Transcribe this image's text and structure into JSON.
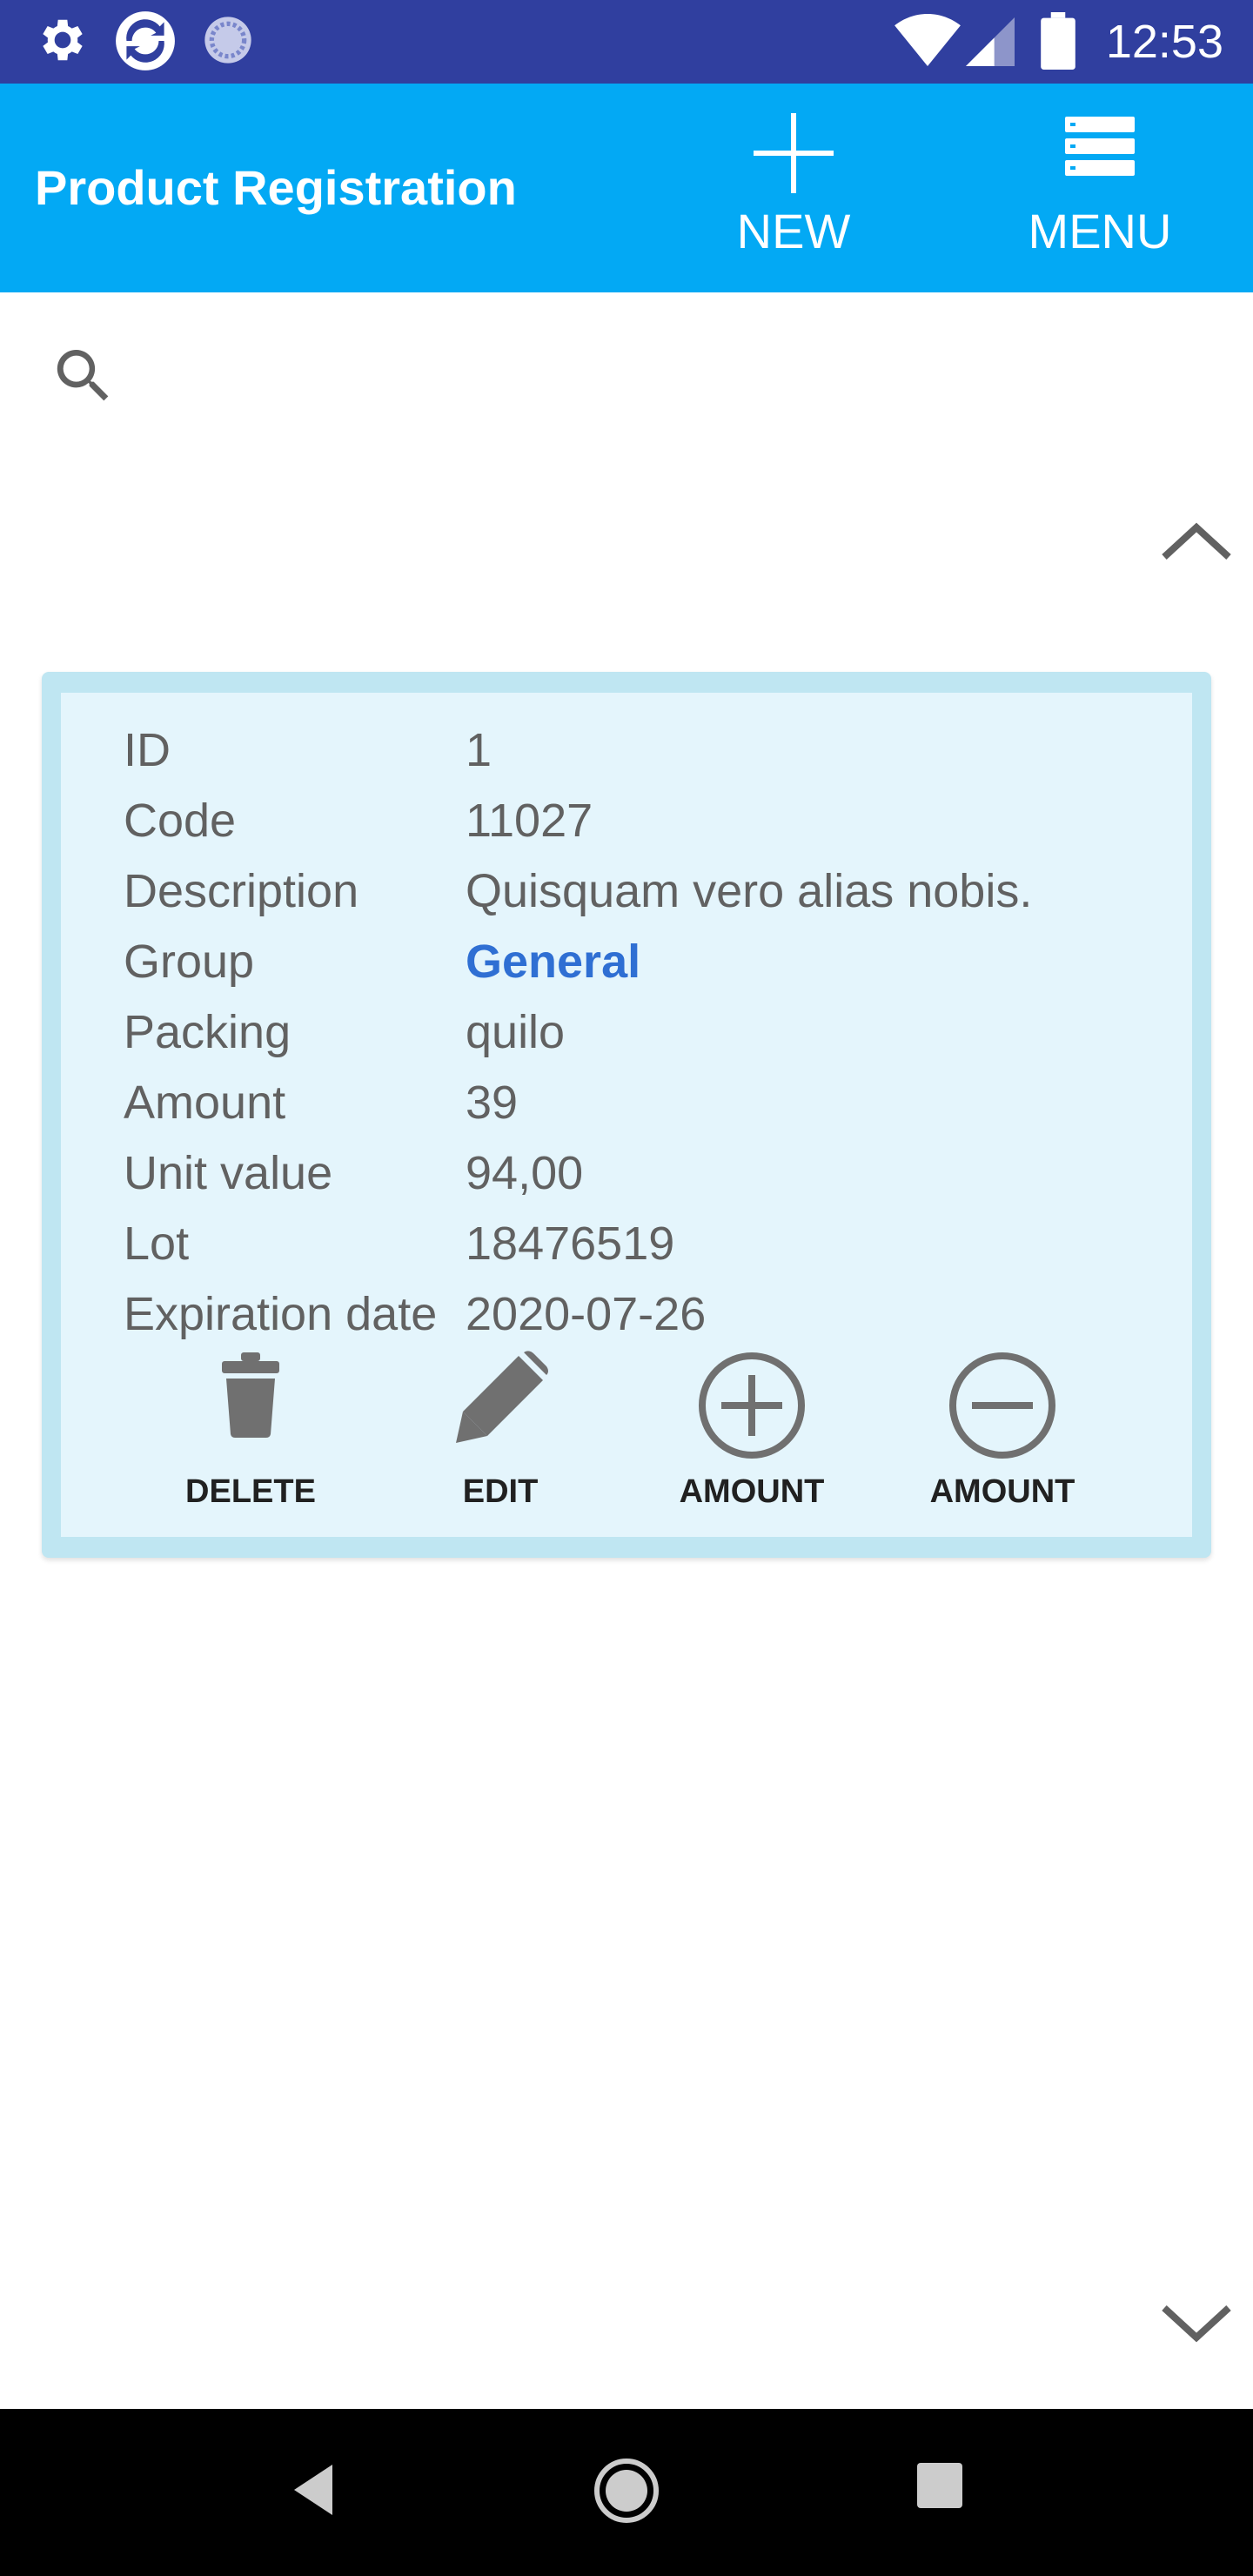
{
  "status_bar": {
    "time": "12:53",
    "icons": [
      "settings-icon",
      "app-sync-icon",
      "loading-circle-icon",
      "wifi-icon",
      "signal-icon",
      "battery-icon"
    ]
  },
  "app_bar": {
    "title": "Product Registration",
    "new_label": "NEW",
    "menu_label": "MENU",
    "background": "#03A9F4"
  },
  "product": {
    "fields": [
      {
        "key": "ID",
        "value": "1"
      },
      {
        "key": "Code",
        "value": "11027"
      },
      {
        "key": "Description",
        "value": "Quisquam vero alias nobis."
      },
      {
        "key": "Group",
        "value": "General"
      },
      {
        "key": "Packing",
        "value": "quilo"
      },
      {
        "key": "Amount",
        "value": "39"
      },
      {
        "key": "Unit value",
        "value": "94,00"
      },
      {
        "key": "Lot",
        "value": "18476519"
      },
      {
        "key": "Expiration date",
        "value": "2020-07-26"
      }
    ],
    "actions": {
      "delete_label": "DELETE",
      "edit_label": "EDIT",
      "increase_label": "AMOUNT",
      "decrease_label": "AMOUNT"
    }
  },
  "nav_bar": {
    "icons": [
      "back-icon",
      "home-icon",
      "recents-icon"
    ]
  }
}
